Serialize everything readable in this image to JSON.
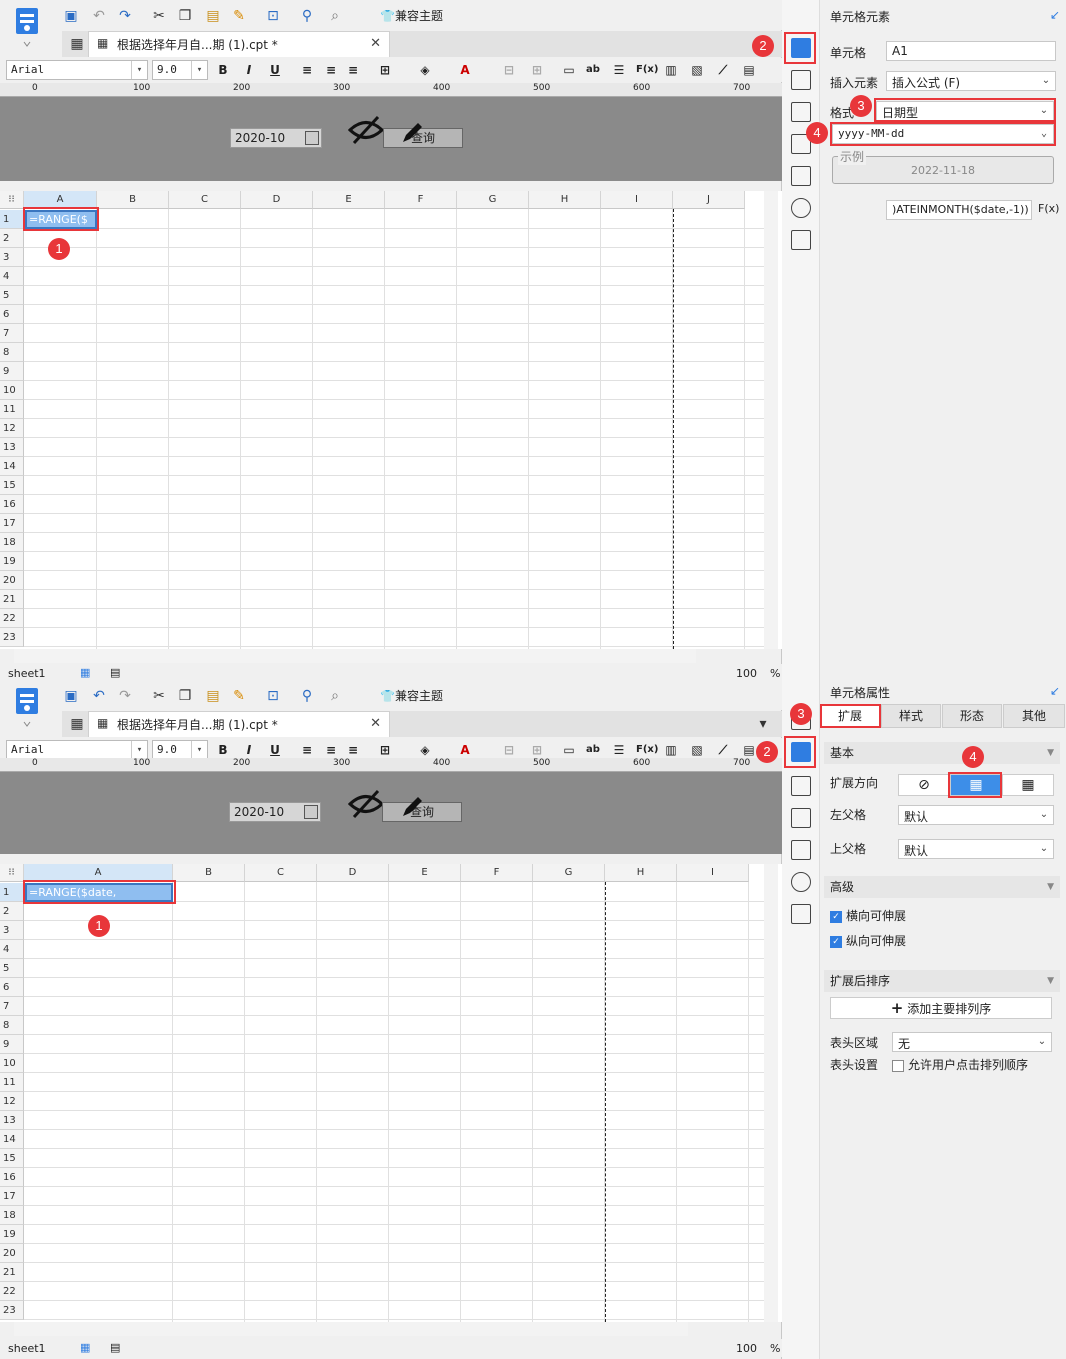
{
  "app": {
    "theme_label": "兼容主题",
    "tab_title": "根据选择年月自...期 (1).cpt *",
    "font_name": "Arial",
    "font_size": "9.0",
    "sheet_name": "sheet1",
    "zoom": "100",
    "zoom_unit": "%"
  },
  "param": {
    "date_value": "2020-10",
    "query_label": "查询"
  },
  "ruler_ticks": [
    "0",
    "100",
    "200",
    "300",
    "400",
    "500",
    "600",
    "700"
  ],
  "top": {
    "columns": [
      "A",
      "B",
      "C",
      "D",
      "E",
      "F",
      "G",
      "H",
      "I",
      "J"
    ],
    "rows": [
      "1",
      "2",
      "3",
      "4",
      "5",
      "6",
      "7",
      "8",
      "9",
      "10",
      "11",
      "12",
      "13",
      "14",
      "15",
      "16",
      "17",
      "18",
      "19",
      "20",
      "21",
      "22",
      "23"
    ],
    "cell_text": "=RANGE($",
    "badge1": "1",
    "badge2": "2",
    "badge3": "3",
    "badge4": "4",
    "panel": {
      "title": "单元格元素",
      "cell_label": "单元格",
      "cell_value": "A1",
      "insert_label": "插入元素",
      "insert_value": "插入公式 (F)",
      "format_label": "格式",
      "format_value": "日期型",
      "pattern_value": "yyyy-MM-dd",
      "example_label": "示例",
      "example_value": "2022-11-18",
      "formula_value": ")ATEINMONTH($date,-1))",
      "fx": "F(x)"
    }
  },
  "bottom": {
    "columns": [
      "A",
      "B",
      "C",
      "D",
      "E",
      "F",
      "G",
      "H",
      "I"
    ],
    "rows": [
      "1",
      "2",
      "3",
      "4",
      "5",
      "6",
      "7",
      "8",
      "9",
      "10",
      "11",
      "12",
      "13",
      "14",
      "15",
      "16",
      "17",
      "18",
      "19",
      "20",
      "21",
      "22",
      "23"
    ],
    "cell_text": "=RANGE($date,",
    "badge1": "1",
    "badge2": "2",
    "badge3": "3",
    "badge4": "4",
    "panel": {
      "title": "单元格属性",
      "tabs": [
        "扩展",
        "样式",
        "形态",
        "其他"
      ],
      "basic": "基本",
      "direction_label": "扩展方向",
      "left_parent_label": "左父格",
      "left_parent_value": "默认",
      "top_parent_label": "上父格",
      "top_parent_value": "默认",
      "advanced": "高级",
      "h_expand": "横向可伸展",
      "v_expand": "纵向可伸展",
      "sort_section": "扩展后排序",
      "add_sort": "添加主要排列序",
      "header_area_label": "表头区域",
      "header_area_value": "无",
      "header_setting_label": "表头设置",
      "allow_sort": "允许用户点击排列顺序"
    }
  }
}
